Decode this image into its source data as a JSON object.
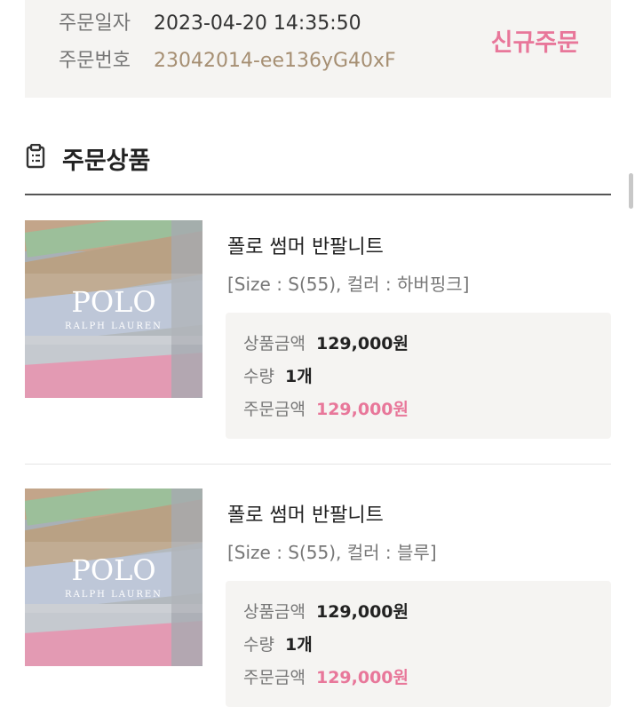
{
  "order": {
    "date_label": "주문일자",
    "date_value": "2023-04-20 14:35:50",
    "number_label": "주문번호",
    "number_value": "23042014-ee136yG40xF",
    "status": "신규주문"
  },
  "section": {
    "icon": "clipboard-icon",
    "title": "주문상품"
  },
  "products": [
    {
      "name": "폴로 썸머 반팔니트",
      "option": "[Size : S(55), 컬러 : 하버핑크]",
      "price_label": "상품금액",
      "price_value": "129,000원",
      "qty_label": "수량",
      "qty_value": "1개",
      "total_label": "주문금액",
      "total_value": "129,000원",
      "image": {
        "brand": "POLO",
        "sub": "RALPH LAUREN"
      }
    },
    {
      "name": "폴로 썸머 반팔니트",
      "option": "[Size : S(55), 컬러 : 블루]",
      "price_label": "상품금액",
      "price_value": "129,000원",
      "qty_label": "수량",
      "qty_value": "1개",
      "total_label": "주문금액",
      "total_value": "129,000원",
      "image": {
        "brand": "POLO",
        "sub": "RALPH LAUREN"
      }
    }
  ],
  "colors": {
    "accent_pink": "#e8779a",
    "order_number": "#a68f73",
    "panel_bg": "#f5f4f2"
  }
}
